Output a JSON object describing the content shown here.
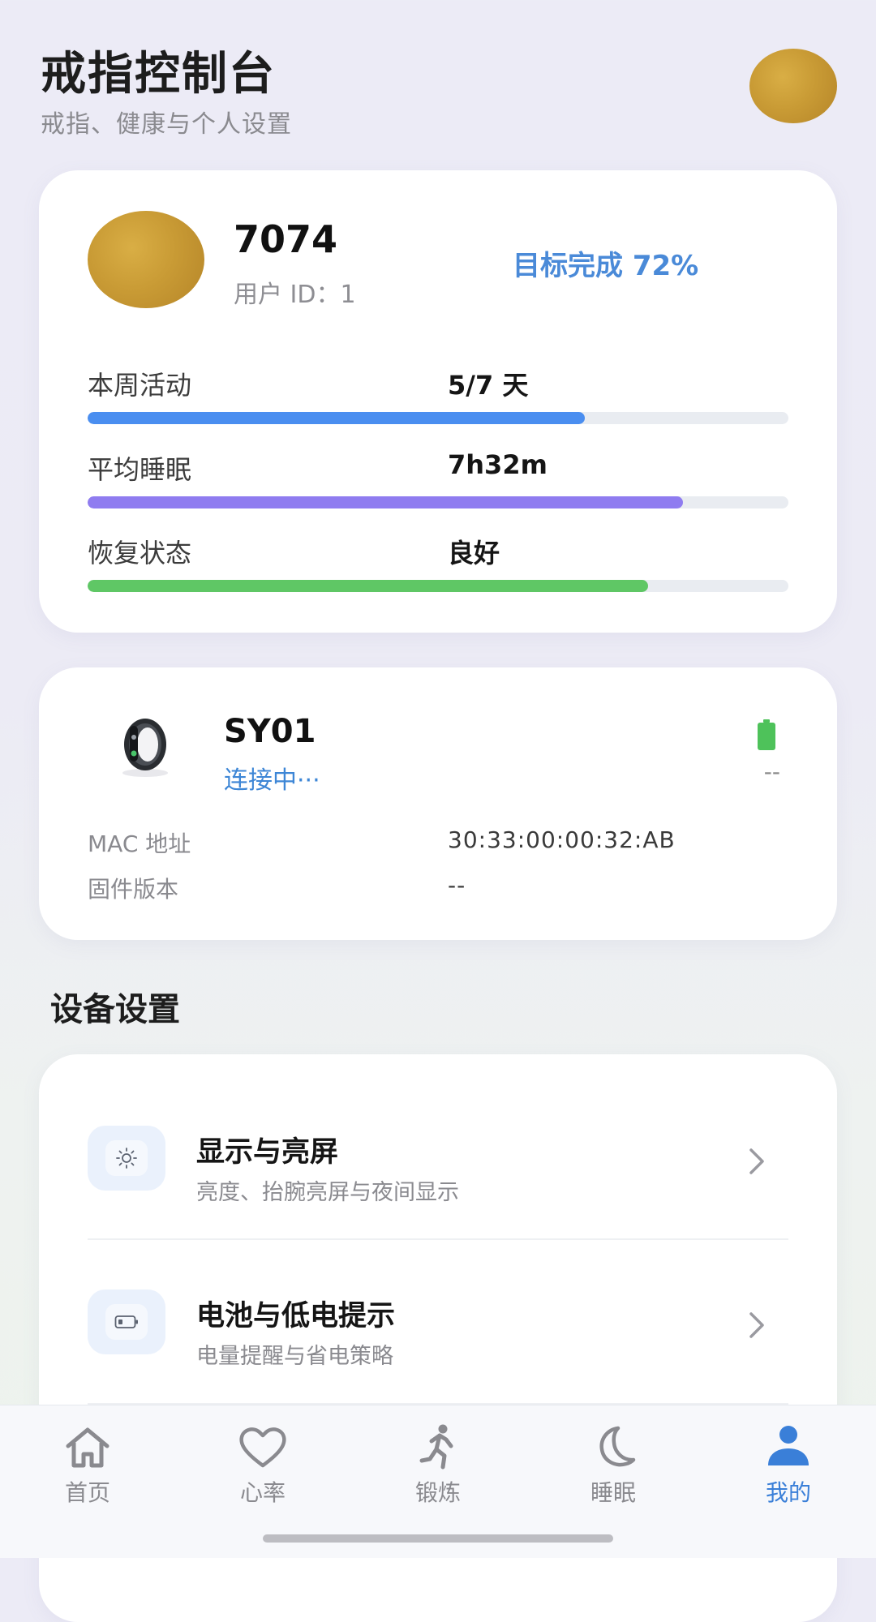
{
  "header": {
    "title": "戒指控制台",
    "subtitle": "戒指、健康与个人设置"
  },
  "profile": {
    "name": "7074",
    "user_id": "用户 ID：1",
    "goal": "目标完成 72%",
    "stats": [
      {
        "label": "本周活动",
        "value": "5/7 天",
        "progress": 0.71,
        "color": "#4a8ef0"
      },
      {
        "label": "平均睡眠",
        "value": "7h32m",
        "progress": 0.85,
        "color": "#8f7cf0"
      },
      {
        "label": "恢复状态",
        "value": "良好",
        "progress": 0.8,
        "color": "#5fc765"
      }
    ]
  },
  "device": {
    "name": "SY01",
    "status": "连接中···",
    "battery_text": "--",
    "battery_color": "#4ec25a",
    "mac_label": "MAC 地址",
    "mac_value": "30:33:00:00:32:AB",
    "firmware_label": "固件版本",
    "firmware_value": "--"
  },
  "settings": {
    "section_title": "设备设置",
    "items": [
      {
        "title": "显示与亮屏",
        "subtitle": "亮度、抬腕亮屏与夜间显示",
        "icon": "sun-icon"
      },
      {
        "title": "电池与低电提示",
        "subtitle": "电量提醒与省电策略",
        "icon": "battery-icon"
      }
    ]
  },
  "nav": {
    "items": [
      {
        "label": "首页",
        "icon": "home-icon",
        "active": false
      },
      {
        "label": "心率",
        "icon": "heart-icon",
        "active": false
      },
      {
        "label": "锻炼",
        "icon": "running-icon",
        "active": false
      },
      {
        "label": "睡眠",
        "icon": "moon-icon",
        "active": false
      },
      {
        "label": "我的",
        "icon": "person-icon",
        "active": true
      }
    ],
    "active_color": "#3a7fd8",
    "inactive_color": "#8a8a8f"
  }
}
